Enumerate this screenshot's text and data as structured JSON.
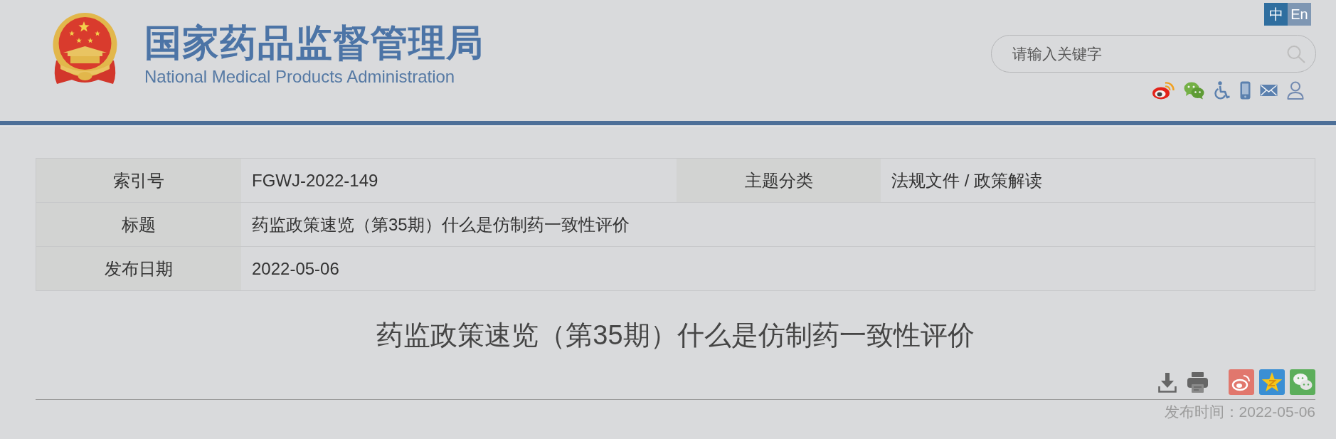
{
  "header": {
    "site_title": "国家药品监督管理局",
    "site_subtitle": "National Medical Products Administration",
    "languages": [
      {
        "label": "中",
        "selected": true
      },
      {
        "label": "En",
        "selected": false
      }
    ],
    "search": {
      "placeholder": "请输入关键字"
    }
  },
  "info_table": {
    "rows": [
      {
        "cells": [
          {
            "label": "索引号",
            "value": "FGWJ-2022-149"
          },
          {
            "label": "主题分类",
            "value": "法规文件 / 政策解读"
          }
        ]
      },
      {
        "cells": [
          {
            "label": "标题",
            "value": "药监政策速览（第35期）什么是仿制药一致性评价"
          }
        ]
      },
      {
        "cells": [
          {
            "label": "发布日期",
            "value": "2022-05-06"
          }
        ]
      }
    ]
  },
  "article": {
    "title": "药监政策速览（第35期）什么是仿制药一致性评价",
    "publish_time": "发布时间：2022-05-06"
  }
}
